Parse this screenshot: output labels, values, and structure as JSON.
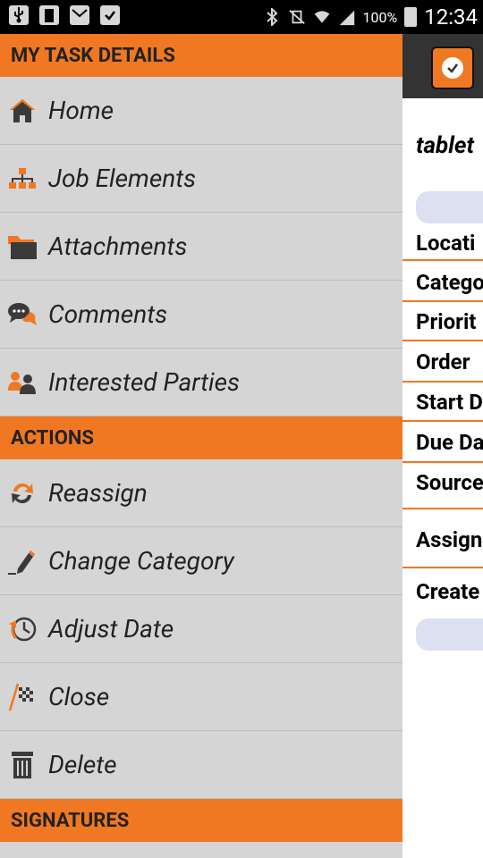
{
  "status_bar": {
    "battery_percent": "100%",
    "time": "12:34"
  },
  "drawer": {
    "sections": [
      {
        "title": "MY TASK DETAILS",
        "items": [
          {
            "label": "Home",
            "icon": "home-icon"
          },
          {
            "label": "Job Elements",
            "icon": "hierarchy-icon"
          },
          {
            "label": "Attachments",
            "icon": "folder-icon"
          },
          {
            "label": "Comments",
            "icon": "comments-icon"
          },
          {
            "label": "Interested Parties",
            "icon": "people-icon"
          }
        ]
      },
      {
        "title": "ACTIONS",
        "items": [
          {
            "label": "Reassign",
            "icon": "reassign-icon"
          },
          {
            "label": "Change Category",
            "icon": "pencil-icon"
          },
          {
            "label": "Adjust Date",
            "icon": "clock-icon"
          },
          {
            "label": "Close",
            "icon": "checkered-flag-icon"
          },
          {
            "label": "Delete",
            "icon": "trash-icon"
          }
        ]
      },
      {
        "title": "SIGNATURES",
        "items": []
      }
    ]
  },
  "main": {
    "task_title": "tablet",
    "fields": [
      "Locati",
      "Catego",
      "Priorit",
      "Order",
      "Start D",
      "Due Da",
      "Source",
      "Assign",
      "Create"
    ]
  },
  "colors": {
    "accent": "#f07822",
    "drawer_bg": "#d5d5d5",
    "action_bar": "#333333"
  }
}
